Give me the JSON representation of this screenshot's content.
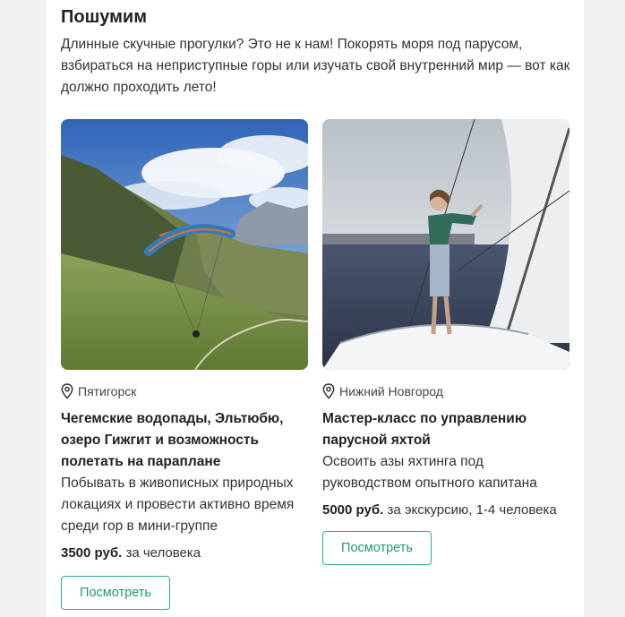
{
  "section": {
    "title": "Пошумим",
    "intro": "Длинные скучные прогулки? Это не к нам! Покорять моря под парусом, взбираться на неприступные горы или изучать свой внутренний мир — вот как должно проходить лето!"
  },
  "cards": [
    {
      "location": "Пятигорск",
      "title": "Чегемские водопады, Эльтюбю, озеро Гижгит и возможность полетать на параплане",
      "description": "Побывать в живописных природных локациях и провести активно время среди гор в мини-группе",
      "price": "3500 руб.",
      "price_note": " за человека",
      "button": "Посмотреть",
      "photo_icon": "paraglider-mountains-photo"
    },
    {
      "location": "Нижний Новгород",
      "title": "Мастер-класс по управлению парусной яхтой",
      "description": "Освоить азы яхтинга под руководством опытного капитана",
      "price": "5000 руб.",
      "price_note": " за экскурсию, 1-4 человека",
      "button": "Посмотреть",
      "photo_icon": "sailing-yacht-photo"
    }
  ],
  "colors": {
    "accent": "#2bb088",
    "page_bg": "#f1f1f1",
    "panel_bg": "#ffffff"
  }
}
